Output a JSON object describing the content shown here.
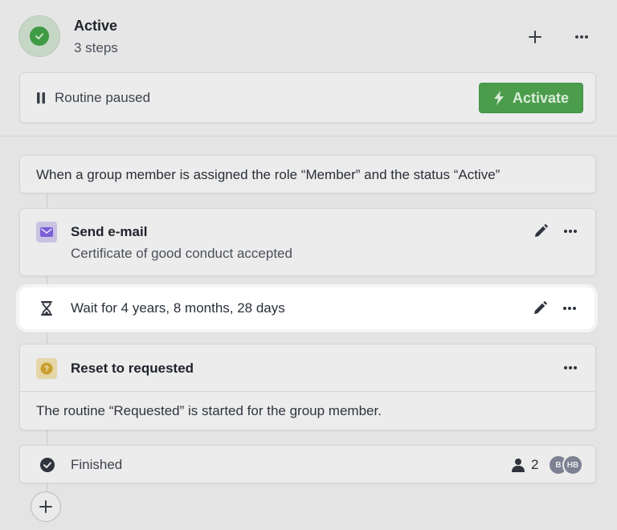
{
  "routine": {
    "status": "Active",
    "steps_count": "3 steps"
  },
  "paused": {
    "label": "Routine paused",
    "activate_label": "Activate"
  },
  "trigger": {
    "text": "When a group member is assigned the role “Member” and the status “Active”"
  },
  "steps": [
    {
      "title": "Send e-mail",
      "subtitle": "Certificate of good conduct accepted",
      "icon": "mail-icon"
    },
    {
      "text": "Wait for 4 years, 8 months, 28 days",
      "icon": "hourglass-icon"
    },
    {
      "title": "Reset to requested",
      "description": "The routine “Requested” is started for the group member.",
      "icon": "question-icon"
    }
  ],
  "finished": {
    "label": "Finished",
    "count": "2",
    "avatars": [
      "B",
      "HB"
    ]
  },
  "colors": {
    "active_green": "#3f9a44",
    "activate_button": "#4b9d4c",
    "mail_icon_bg": "#7b5fd6",
    "question_icon_bg": "#e0b030"
  }
}
